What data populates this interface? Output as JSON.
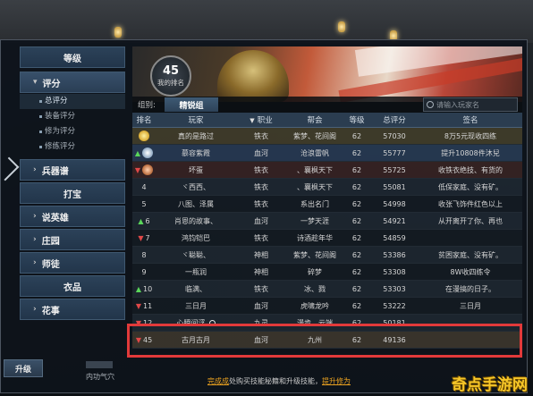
{
  "menu": {
    "level": "等级",
    "score": "评分",
    "sub_items": [
      "总评分",
      "装备评分",
      "修为评分",
      "修练评分"
    ],
    "weapon_spectrum": "兵器谱",
    "dabao": "打宝",
    "heroes": "说英雄",
    "manor": "庄园",
    "apprentice": "师徒",
    "clothes": "衣品",
    "flower": "花事",
    "upgrade": "升级",
    "inner_skill": "内功气穴"
  },
  "banner": {
    "rank_number": "45",
    "rank_label": "我的排名"
  },
  "group": {
    "label": "组别:",
    "tab": "精锐组"
  },
  "search": {
    "placeholder": "请输入玩家名"
  },
  "table": {
    "headers": {
      "rank": "排名",
      "player": "玩家",
      "job": "职业",
      "guild": "帮会",
      "level": "等级",
      "score": "总评分",
      "sign": "签名"
    },
    "rows": [
      {
        "rank": "1",
        "player": "真的是路过",
        "job": "铁衣",
        "guild": "紫梦、花间阁",
        "level": "62",
        "score": "57030",
        "sign": "8万5元现收四练",
        "trend": "none",
        "medal": "gold"
      },
      {
        "rank": "2",
        "player": "慕容紫霞",
        "job": "血河",
        "guild": "沧浪雷帆",
        "level": "62",
        "score": "55777",
        "sign": "提升10808件沐兒",
        "trend": "up",
        "medal": "silver"
      },
      {
        "rank": "3",
        "player": "坏蛋",
        "job": "铁衣",
        "guild": "、襄枫天下",
        "level": "62",
        "score": "55725",
        "sign": "收铁衣绝技、有货的",
        "trend": "down",
        "medal": "bronze"
      },
      {
        "rank": "4",
        "player": "ヾ西西、",
        "job": "铁衣",
        "guild": "、襄枫天下",
        "level": "62",
        "score": "55081",
        "sign": "低保家庭、没有矿。",
        "trend": "none",
        "medal": ""
      },
      {
        "rank": "5",
        "player": "八图、泽属",
        "job": "铁衣",
        "guild": "系出名门",
        "level": "62",
        "score": "54998",
        "sign": "收张飞饰件红色以上",
        "trend": "none",
        "medal": ""
      },
      {
        "rank": "6",
        "player": "肖恩的故事、",
        "job": "血河",
        "guild": "一梦天涯",
        "level": "62",
        "score": "54921",
        "sign": "从开离开了你、再也",
        "trend": "up",
        "medal": ""
      },
      {
        "rank": "7",
        "player": "鸿钧铠巴",
        "job": "铁衣",
        "guild": "诗酒趁年华",
        "level": "62",
        "score": "54859",
        "sign": "",
        "trend": "down",
        "medal": ""
      },
      {
        "rank": "8",
        "player": "ヾ聪聪、",
        "job": "神相",
        "guild": "紫梦、花间阁",
        "level": "62",
        "score": "53386",
        "sign": "贫困家庭、没有矿。",
        "trend": "none",
        "medal": ""
      },
      {
        "rank": "9",
        "player": "一瓶润",
        "job": "神相",
        "guild": "碎梦",
        "level": "62",
        "score": "53308",
        "sign": "8W收四练令",
        "trend": "none",
        "medal": ""
      },
      {
        "rank": "10",
        "player": "临满、",
        "job": "铁衣",
        "guild": "冰、戮",
        "level": "62",
        "score": "53303",
        "sign": "在漫搞的日子。",
        "trend": "up",
        "medal": ""
      },
      {
        "rank": "11",
        "player": "三日月",
        "job": "血河",
        "guild": "虎啸龙吟",
        "level": "62",
        "score": "53222",
        "sign": "三日月",
        "trend": "down",
        "medal": ""
      },
      {
        "rank": "12",
        "player": "心瞬间浮",
        "job": "九灵",
        "guild": "漫步、云端",
        "level": "62",
        "score": "50181",
        "sign": "",
        "trend": "down",
        "medal": ""
      },
      {
        "rank": "45",
        "player": "古月古月",
        "job": "血河",
        "guild": "九州",
        "level": "62",
        "score": "49136",
        "sign": "",
        "trend": "down",
        "medal": ""
      }
    ]
  },
  "tip": {
    "link": "完成成",
    "text": "处购买技能秘籍和升级技能，",
    "link2": "提升修为"
  },
  "watermark": "奇点手游网",
  "colors": {
    "highlight_box": "#e23a3a",
    "up": "#5ad65a",
    "down": "#e04848",
    "link": "#e8a020"
  }
}
